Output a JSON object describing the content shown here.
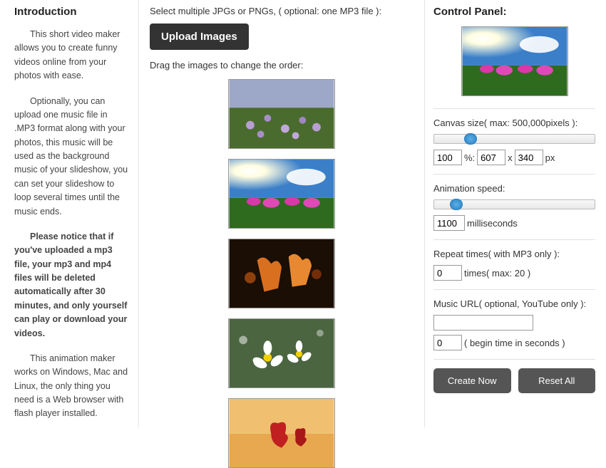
{
  "intro": {
    "heading": "Introduction",
    "p1": "This short video maker allows you to create funny videos online from your photos with ease.",
    "p2": "Optionally, you can upload one music file in .MP3 format along with your photos, this music will be used as the background music of your slideshow, you can set your slideshow to loop several times until the music ends.",
    "p3": "Please notice that if you've uploaded a mp3 file, your mp3 and mp4 files will be deleted automatically after 30 minutes, and only yourself can play or download your videos.",
    "p4": "This animation maker works on Windows, Mac and Linux, the only thing you need is a Web browser with flash player installed."
  },
  "uploader": {
    "instruction": "Select multiple JPGs or PNGs, ( optional: one MP3 file ):",
    "button": "Upload Images",
    "drag_label": "Drag the images to change the order:"
  },
  "panel": {
    "heading": "Control Panel:",
    "canvas_label": "Canvas size( max: 500,000pixels ):",
    "canvas_percent": "100",
    "canvas_percent_unit": "%:",
    "canvas_w": "607",
    "canvas_x": "x",
    "canvas_h": "340",
    "canvas_unit": "px",
    "anim_label": "Animation speed:",
    "anim_value": "1100",
    "anim_unit": "milliseconds",
    "repeat_label": "Repeat times( with MP3 only ):",
    "repeat_value": "0",
    "repeat_unit": "times( max: 20 )",
    "music_label": "Music URL( optional, YouTube only ):",
    "music_url": "",
    "music_begin": "0",
    "music_begin_unit": "( begin time in seconds )",
    "create_btn": "Create Now",
    "reset_btn": "Reset All"
  }
}
